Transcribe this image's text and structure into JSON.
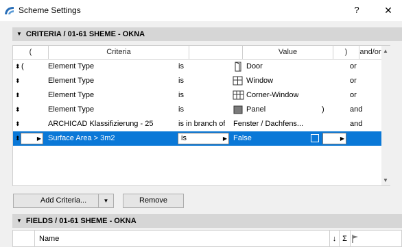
{
  "window": {
    "title": "Scheme Settings",
    "help_label": "?",
    "close_label": "✕"
  },
  "criteria_section": {
    "title": "CRITERIA / 01-61 SHEME - OKNA"
  },
  "criteria_table": {
    "headers": [
      "(",
      "Criteria",
      "Value",
      ")",
      "and/or"
    ],
    "rows": [
      {
        "paren_open": "(",
        "criteria": "Element Type",
        "operator": "is",
        "value_icon": "door-icon",
        "value": "Door",
        "paren_close": "",
        "andor": "or"
      },
      {
        "paren_open": "",
        "criteria": "Element Type",
        "operator": "is",
        "value_icon": "window-icon",
        "value": "Window",
        "paren_close": "",
        "andor": "or"
      },
      {
        "paren_open": "",
        "criteria": "Element Type",
        "operator": "is",
        "value_icon": "corner-window-icon",
        "value": "Corner-Window",
        "paren_close": "",
        "andor": "or"
      },
      {
        "paren_open": "",
        "criteria": "Element Type",
        "operator": "is",
        "value_icon": "panel-icon",
        "value": "Panel",
        "paren_close": ")",
        "andor": "and"
      },
      {
        "paren_open": "",
        "criteria": "ARCHICAD Klassifizierung - 25",
        "operator": "is in branch of",
        "value_icon": "",
        "value": "Fenster / Dachfens...",
        "paren_close": "",
        "andor": "and"
      }
    ],
    "selected_row": {
      "paren_open": "",
      "criteria": "Surface Area > 3m2",
      "operator": "is",
      "value": "False",
      "paren_close": "",
      "andor": ""
    }
  },
  "buttons": {
    "add_criteria": "Add Criteria...",
    "remove": "Remove"
  },
  "fields_section": {
    "title": "FIELDS / 01-61 SHEME - OKNA"
  },
  "fields_table": {
    "headers": [
      "Name"
    ],
    "sort_symbol": "↓",
    "sum_symbol": "Σ"
  },
  "colors": {
    "selection": "#0a78d7",
    "section_header": "#d6d6d6",
    "background": "#f0f0f0"
  }
}
